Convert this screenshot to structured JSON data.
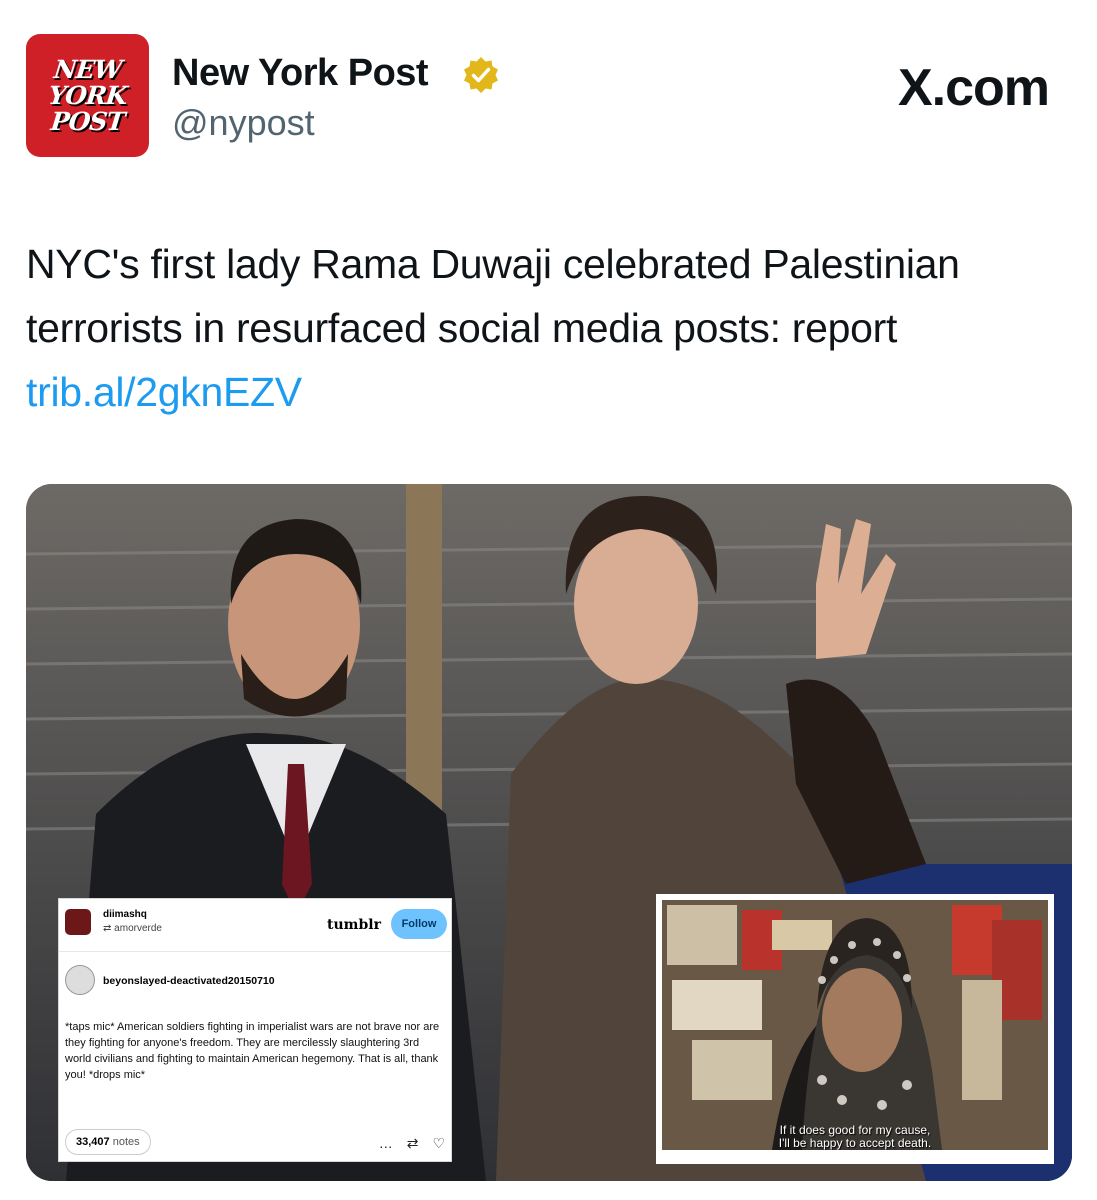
{
  "account": {
    "logo_lines": [
      "NEW",
      "YORK",
      "POST"
    ],
    "name": "New York Post",
    "handle": "@nypost"
  },
  "source": "X.com",
  "tweet": {
    "text": "NYC's first lady Rama Duwaji celebrated Palestinian terrorists in resurfaced social media posts: report",
    "link": "trib.al/2gknEZV"
  },
  "tumblr_card": {
    "user": "diimashq",
    "reblog_from": "amorverde",
    "brand": "tumblr",
    "follow_label": "Follow",
    "original_user": "beyonslayed-deactivated20150710",
    "body": "*taps mic* American soldiers fighting in imperialist wars are not brave nor are they fighting for anyone's freedom. They are mercilessly slaughtering 3rd world civilians and fighting to maintain American hegemony. That is all, thank you! *drops mic*",
    "notes_count": "33,407",
    "notes_label": "notes",
    "actions": [
      "…",
      "⇄",
      "♡"
    ]
  },
  "video_still": {
    "subtitle_line1": "If it does good for my cause,",
    "subtitle_line2": "I'll be happy to accept death."
  },
  "colors": {
    "brand_red": "#cf2027",
    "link_blue": "#1d9bf0",
    "verified_gold": "#e2b719",
    "handle_gray": "#536471"
  }
}
